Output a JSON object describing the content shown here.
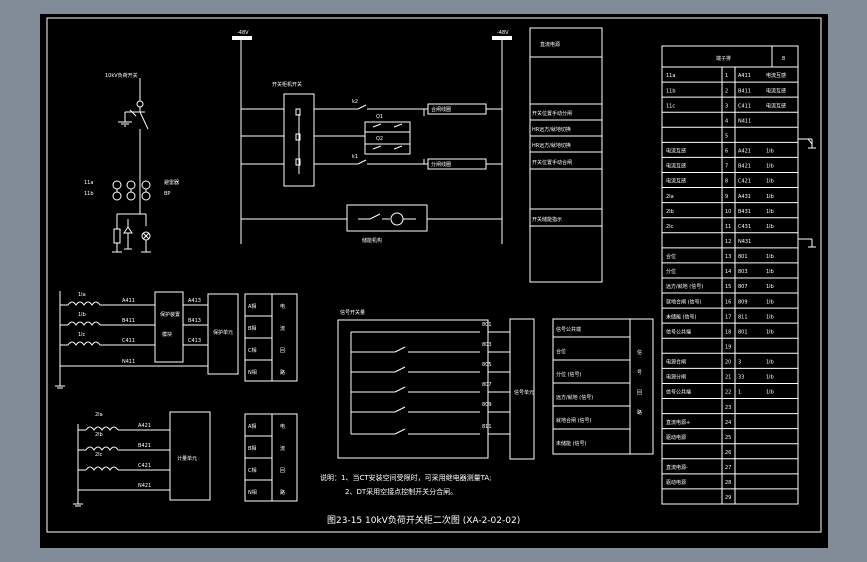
{
  "bus_labels": [
    "-48V",
    "-48V"
  ],
  "ground_switch_label": "10kV负荷开关",
  "switch_device_label": "开关柜机开关",
  "ct_labels": [
    "11a",
    "11b"
  ],
  "arrester_label": "避雷器",
  "contacts": {
    "k2": "k2",
    "k1": "k1"
  },
  "relay_labels": [
    "合闸线圈",
    "分闸线圈"
  ],
  "motor_label": "储能机构",
  "func_col": {
    "header": "直流电源",
    "items": [
      "开关位置手动分闸",
      "HR远方/就地切换",
      "HR远方/就地切换",
      "开关位置手动合闸",
      "开关储能指示"
    ]
  },
  "terminal_block": {
    "header": "端子排",
    "rows": [
      [
        "11a",
        "1",
        "A411",
        "电流互感"
      ],
      [
        "11b",
        "2",
        "B411",
        "电流互感"
      ],
      [
        "11c",
        "3",
        "C411",
        "电流互感"
      ],
      [
        "",
        "4",
        "N411",
        ""
      ],
      [
        "",
        "5",
        "",
        ""
      ],
      [
        "电流互感",
        "6",
        "A421",
        "1Ib"
      ],
      [
        "电流互感",
        "7",
        "B421",
        "1Ib"
      ],
      [
        "电流互感",
        "8",
        "C421",
        "1Ib"
      ],
      [
        "2Ia",
        "9",
        "A431",
        "1Ib"
      ],
      [
        "2Ib",
        "10",
        "B431",
        "1Ib"
      ],
      [
        "2Ic",
        "11",
        "C431",
        "1Ib"
      ],
      [
        "",
        "12",
        "N431",
        ""
      ],
      [
        "合位",
        "13",
        "801",
        "1Ib"
      ],
      [
        "分位",
        "14",
        "803",
        "1Ib"
      ],
      [
        "远方/就地 (信号)",
        "15",
        "807",
        "1Ib"
      ],
      [
        "就地合闸 (信号)",
        "16",
        "809",
        "1Ib"
      ],
      [
        "未储能 (信号)",
        "17",
        "811",
        "1Ib"
      ],
      [
        "信号公共端",
        "18",
        "801",
        "1Ib"
      ],
      [
        "",
        "19",
        "",
        ""
      ],
      [
        "电源合闸",
        "20",
        "3",
        "1Ib"
      ],
      [
        "电源分闸",
        "21",
        "33",
        "1Ib"
      ],
      [
        "信号公共端",
        "22",
        "1",
        "1Ib"
      ],
      [
        "",
        "23",
        "",
        ""
      ],
      [
        "直流电源+",
        "24",
        "",
        ""
      ],
      [
        "驱动电源",
        "25",
        "",
        ""
      ],
      [
        "",
        "26",
        "",
        ""
      ],
      [
        "直流电源-",
        "27",
        "",
        ""
      ],
      [
        "驱动电源",
        "28",
        "",
        ""
      ],
      [
        "",
        "29",
        "",
        ""
      ]
    ]
  },
  "ct_sets": [
    {
      "coils": [
        "1Ia",
        "1Ib",
        "1Ic"
      ],
      "wires": [
        "A411",
        "B411",
        "C411",
        "N411"
      ],
      "device": "保护装置",
      "device_sub": "模块",
      "out_wires": [
        "A413",
        "B413",
        "C413"
      ],
      "unit": "保护单元"
    },
    {
      "coils": [
        "2Ia",
        "2Ib",
        "2Ic"
      ],
      "wires": [
        "A421",
        "B421",
        "C421",
        "N421"
      ],
      "unit": "计量单元"
    }
  ],
  "legend_boxes": [
    {
      "items": [
        "A相",
        "B相",
        "C相",
        "N相"
      ],
      "side": [
        "电",
        "流",
        "回",
        "路"
      ]
    },
    {
      "items": [
        "A相",
        "B相",
        "C相",
        "N相"
      ],
      "side": [
        "电",
        "流",
        "回",
        "路"
      ]
    }
  ],
  "signal_unit": {
    "title": "信号开关量",
    "codes": [
      "801",
      "803",
      "805",
      "807",
      "809",
      "811"
    ],
    "box": "信号单元"
  },
  "signal_legend": {
    "items": [
      "信号公共端",
      "合位",
      "分位 (信号)",
      "远方/就地 (信号)",
      "就地合闸 (信号)",
      "未储能 (信号)"
    ],
    "side": [
      "信",
      "号",
      "回",
      "路"
    ]
  },
  "notes": [
    "说明：1、当CT安装空间受限时，可采用继电器测量TA;",
    "2、DT采用空接点控制开关分合闸。"
  ],
  "caption": "图23-15 10kV负荷开关柜二次图 (XA-2-02-02)",
  "ground_symbols": "ground-symbol"
}
